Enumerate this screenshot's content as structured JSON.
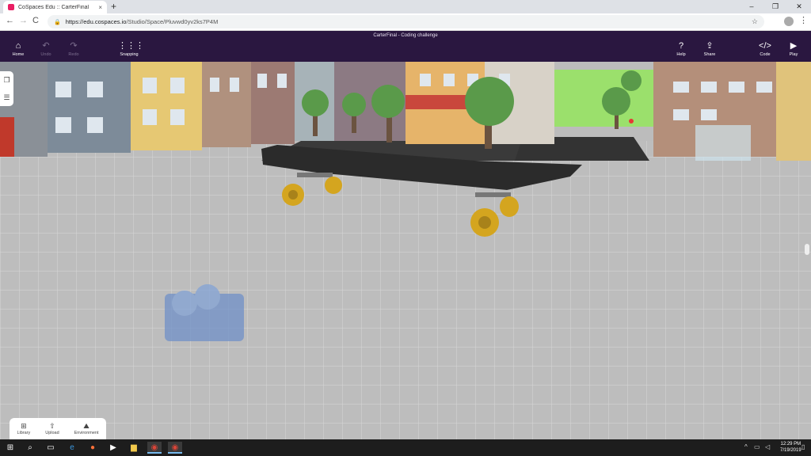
{
  "browser": {
    "tab_title": "CoSpaces Edu :: CarterFinal",
    "tab_close": "×",
    "new_tab": "+",
    "window_controls": [
      "–",
      "❐",
      "✕"
    ],
    "back": "←",
    "forward": "→",
    "reload": "C",
    "url_host": "https://edu.cospaces.io",
    "url_path": "/Studio/Space/Pluvwd0yv2ks7P4M",
    "star": "☆",
    "menu": "⋮"
  },
  "app": {
    "document_title": "CarterFinal - Coding challenge",
    "toolbar": {
      "home": "Home",
      "undo": "Undo",
      "redo": "Redo",
      "snapping": "Snapping",
      "help": "Help",
      "share": "Share",
      "code": "Code",
      "play": "Play"
    },
    "icons": {
      "home": "home-icon",
      "undo": "undo-icon",
      "redo": "redo-icon",
      "snapping": "grid-icon",
      "help": "help-icon",
      "share": "share-icon",
      "code": "code-icon",
      "play": "play-icon"
    },
    "bottom_panel": {
      "library": "Library",
      "upload": "Upload",
      "environment": "Environment"
    }
  },
  "taskbar": {
    "time": "12:29 PM",
    "date": "7/19/2019"
  },
  "colors": {
    "topbar": "#2a1740",
    "sky_green": "#9be06c",
    "skateboard_deck": "#2b2b2b",
    "wheels": "#d4a51f",
    "ground_grid": "#b9b9b9"
  }
}
